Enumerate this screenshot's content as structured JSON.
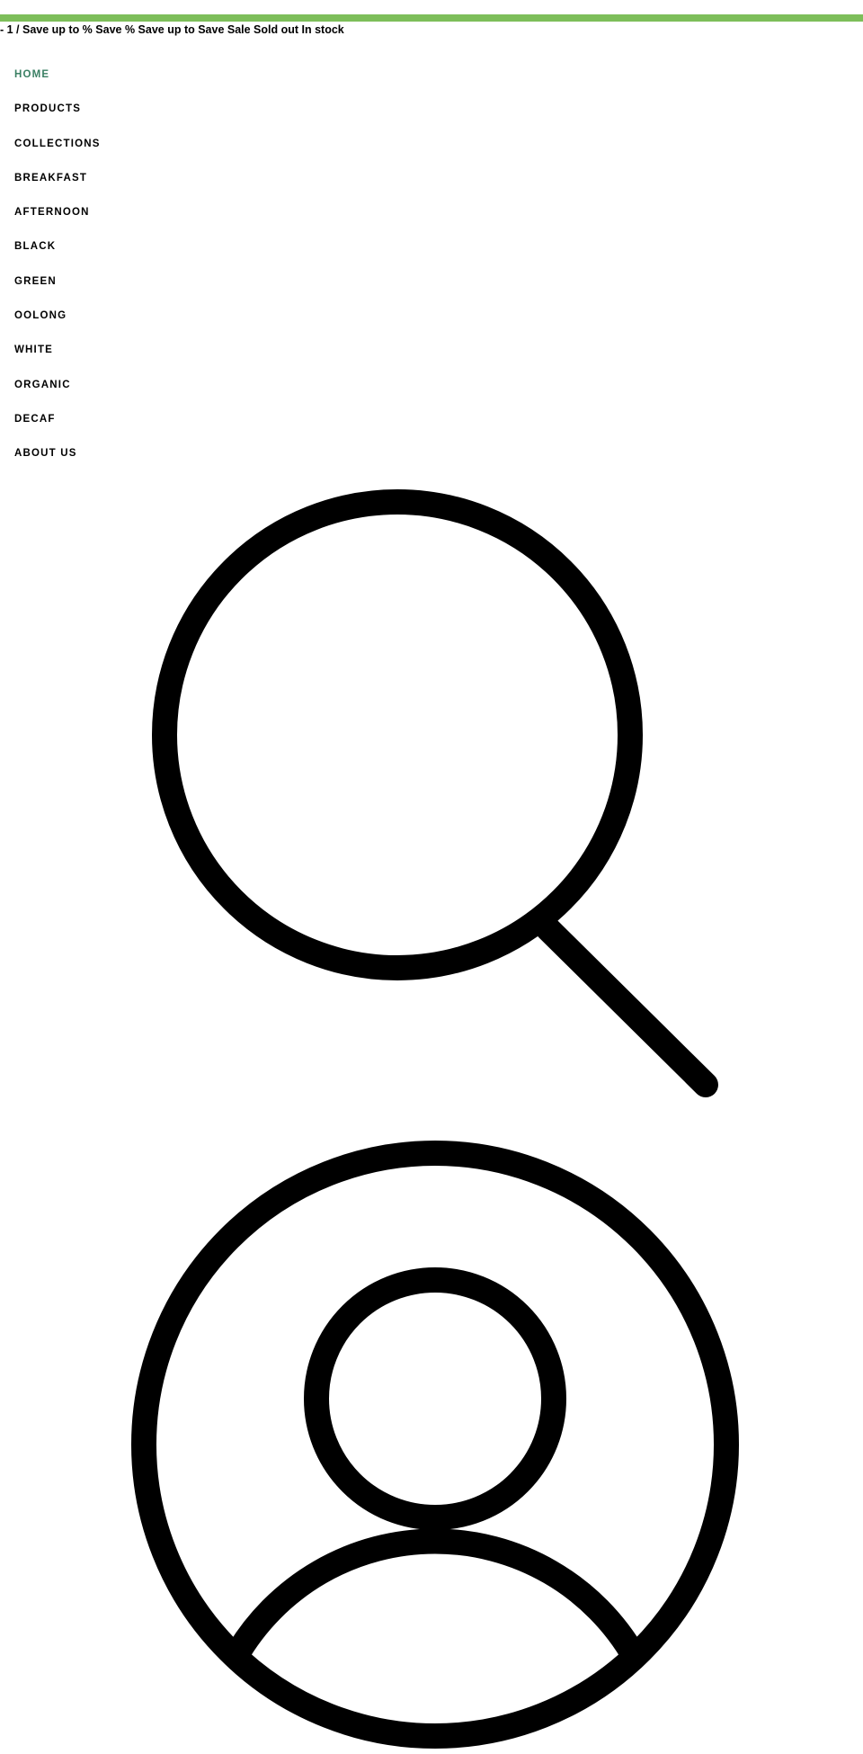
{
  "colors": {
    "accent_bar": "#7dbe5a",
    "nav_active": "#3a7f63",
    "text": "#000000"
  },
  "price_strip": {
    "text": "- 1 / Save up to % Save % Save up to Save Sale Sold out In stock"
  },
  "navigation": {
    "items": [
      {
        "label": "HOME",
        "active": true
      },
      {
        "label": "PRODUCTS",
        "active": false
      },
      {
        "label": "COLLECTIONS",
        "active": false
      },
      {
        "label": "BREAKFAST",
        "active": false
      },
      {
        "label": "AFTERNOON",
        "active": false
      },
      {
        "label": "BLACK",
        "active": false
      },
      {
        "label": "GREEN",
        "active": false
      },
      {
        "label": "OOLONG",
        "active": false
      },
      {
        "label": "WHITE",
        "active": false
      },
      {
        "label": "ORGANIC",
        "active": false
      },
      {
        "label": "DECAF",
        "active": false
      },
      {
        "label": "ABOUT US",
        "active": false
      }
    ]
  },
  "icons": {
    "search": "search-icon",
    "account": "account-icon"
  }
}
